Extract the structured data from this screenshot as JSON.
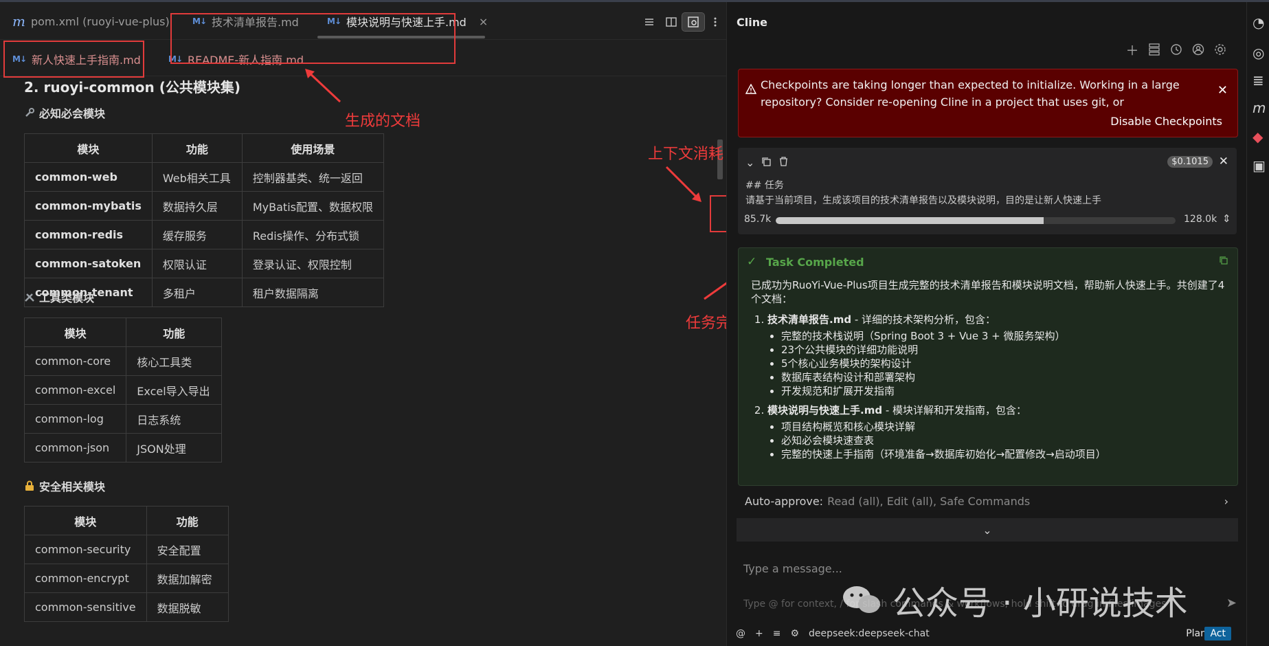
{
  "editor": {
    "tabs_row1": [
      {
        "label": "pom.xml (ruoyi-vue-plus)",
        "icon": "m-icon"
      },
      {
        "label": "技术清单报告.md",
        "icon": "markdown-icon"
      },
      {
        "label": "模块说明与快速上手.md",
        "icon": "markdown-icon",
        "active": true
      }
    ],
    "tabs_row2": [
      {
        "label": "新人快速上手指南.md",
        "icon": "markdown-icon"
      },
      {
        "label": "README-新人指南.md",
        "icon": "markdown-icon"
      }
    ],
    "md_icon_text": "M↓",
    "close_glyph": "×",
    "actions": [
      "list-icon",
      "split-icon",
      "preview-icon",
      "more-icon"
    ]
  },
  "annotations": {
    "generated_docs": "生成的文档",
    "context_usage": "上下文消耗",
    "task_done": "任务完成"
  },
  "doc": {
    "heading": "2. ruoyi-common (公共模块集)",
    "sections": [
      {
        "icon": "wrench-icon",
        "title": "必知必会模块",
        "columns": [
          "模块",
          "功能",
          "使用场景"
        ],
        "rows": [
          [
            "common-web",
            "Web相关工具",
            "控制器基类、统一返回"
          ],
          [
            "common-mybatis",
            "数据持久层",
            "MyBatis配置、数据权限"
          ],
          [
            "common-redis",
            "缓存服务",
            "Redis操作、分布式锁"
          ],
          [
            "common-satoken",
            "权限认证",
            "登录认证、权限控制"
          ],
          [
            "common-tenant",
            "多租户",
            "租户数据隔离"
          ]
        ]
      },
      {
        "icon": "tools-icon",
        "title": "工具类模块",
        "columns": [
          "模块",
          "功能"
        ],
        "rows": [
          [
            "common-core",
            "核心工具类"
          ],
          [
            "common-excel",
            "Excel导入导出"
          ],
          [
            "common-log",
            "日志系统"
          ],
          [
            "common-json",
            "JSON处理"
          ]
        ]
      },
      {
        "icon": "lock-icon",
        "title": "安全相关模块",
        "columns": [
          "模块",
          "功能"
        ],
        "rows": [
          [
            "common-security",
            "安全配置"
          ],
          [
            "common-encrypt",
            "数据加解密"
          ],
          [
            "common-sensitive",
            "数据脱敏"
          ]
        ]
      }
    ]
  },
  "panel": {
    "title": "Cline",
    "icons": [
      "plus-icon",
      "server-icon",
      "history-icon",
      "account-icon",
      "gear-icon"
    ],
    "alert": {
      "message": "Checkpoints are taking longer than expected to initialize. Working in a large repository? Consider re-opening Cline in a project that uses git, or",
      "action": "Disable Checkpoints"
    },
    "task": {
      "cost": "$0.1015",
      "heading": "## 任务",
      "description": "请基于当前项目，生成该项目的技术清单报告以及模块说明，目的是让新人快速上手",
      "context_used": "85.7k",
      "context_max": "128.0k",
      "context_used_value": 85.7,
      "context_max_value": 128.0
    },
    "completed": {
      "title": "Task Completed",
      "intro": "已成功为RuoYi-Vue-Plus项目生成完整的技术清单报告和模块说明文档，帮助新人快速上手。共创建了4个文档：",
      "items": [
        {
          "title": "技术清单报告.md",
          "suffix": " - 详细的技术架构分析，包含：",
          "bullets": [
            "完整的技术栈说明（Spring Boot 3 + Vue 3 + 微服务架构）",
            "23个公共模块的详细功能说明",
            "5个核心业务模块的架构设计",
            "数据库表结构设计和部署架构",
            "开发规范和扩展开发指南"
          ]
        },
        {
          "title": "模块说明与快速上手.md",
          "suffix": " - 模块详解和开发指南，包含：",
          "bullets": [
            "项目结构概览和核心模块详解",
            "必知必会模块速查表",
            "完整的快速上手指南（环境准备→数据库初始化→配置修改→启动项目）"
          ]
        }
      ]
    },
    "auto_approve": {
      "label": "Auto-approve:",
      "value": "Read (all), Edit (all), Safe Commands"
    },
    "input": {
      "placeholder": "Type a message...",
      "hint": "Type @ for context, / for slash commands & workflows, hold shift to drag in files/images"
    },
    "watermark": "公众号 · 小研说技术",
    "bottom": {
      "model": "deepseek:deepseek-chat",
      "plan": "Plan",
      "act": "Act"
    }
  }
}
